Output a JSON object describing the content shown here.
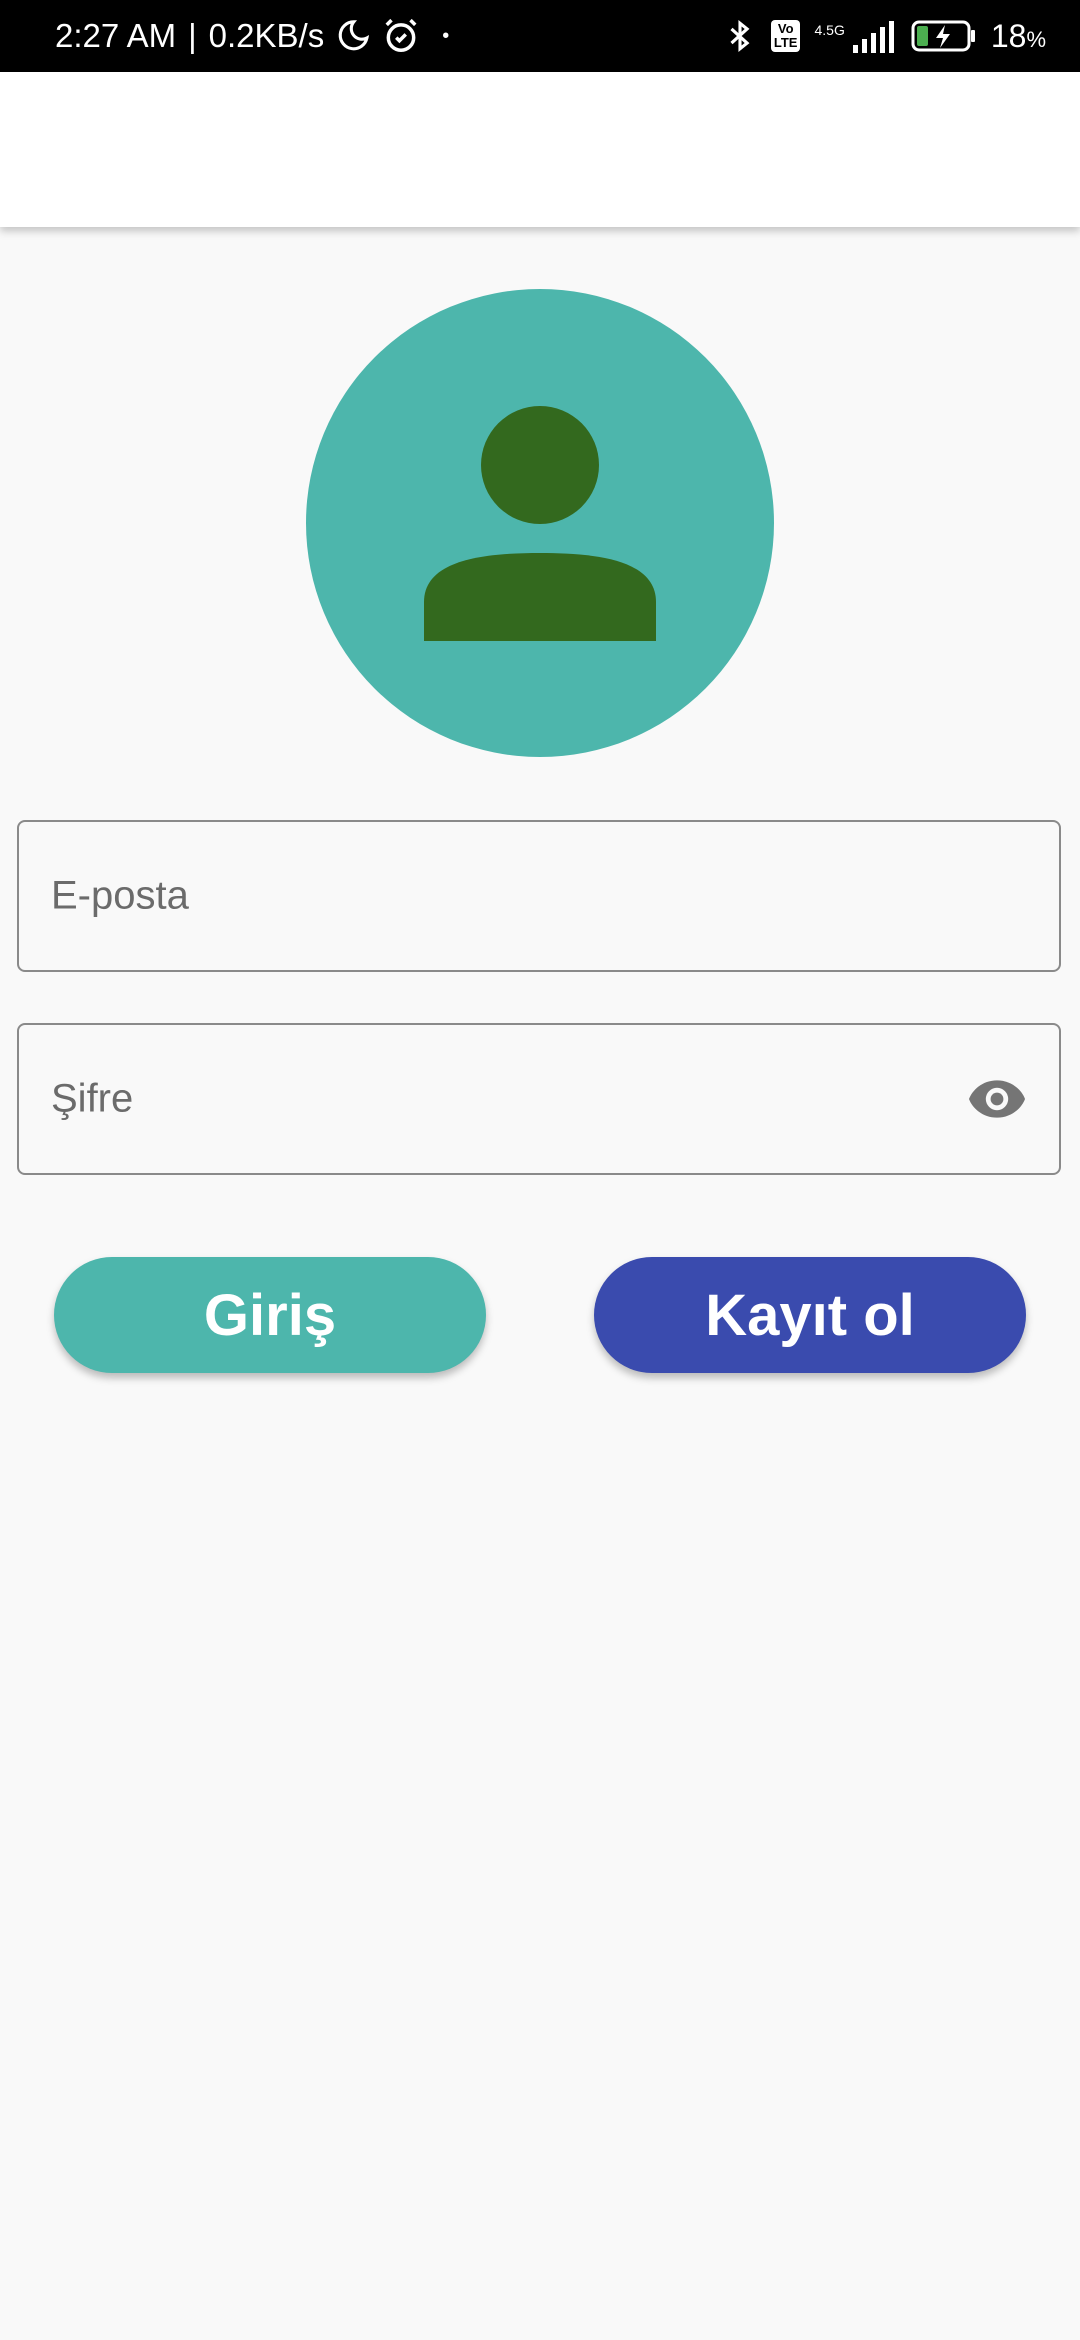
{
  "status_bar": {
    "time": "2:27 AM",
    "separator": "|",
    "net_speed": "0.2KB/s",
    "dot": "•",
    "volte": "Vo\nLTE",
    "network": "4.5G",
    "battery_pct": "18",
    "battery_unit": "%",
    "icons": [
      "moon-icon",
      "alarm-icon",
      "bluetooth-icon",
      "volte-icon",
      "signal-icon",
      "battery-charging-icon"
    ]
  },
  "avatar": {
    "icon": "person-icon",
    "bg_color": "#4db6ac",
    "fg_color": "#33691e"
  },
  "form": {
    "email_label": "E-posta",
    "password_label": "Şifre",
    "password_toggle_icon": "eye-icon"
  },
  "buttons": {
    "login_label": "Giriş",
    "login_color": "#4db6ac",
    "register_label": "Kayıt ol",
    "register_color": "#3a4bae"
  }
}
